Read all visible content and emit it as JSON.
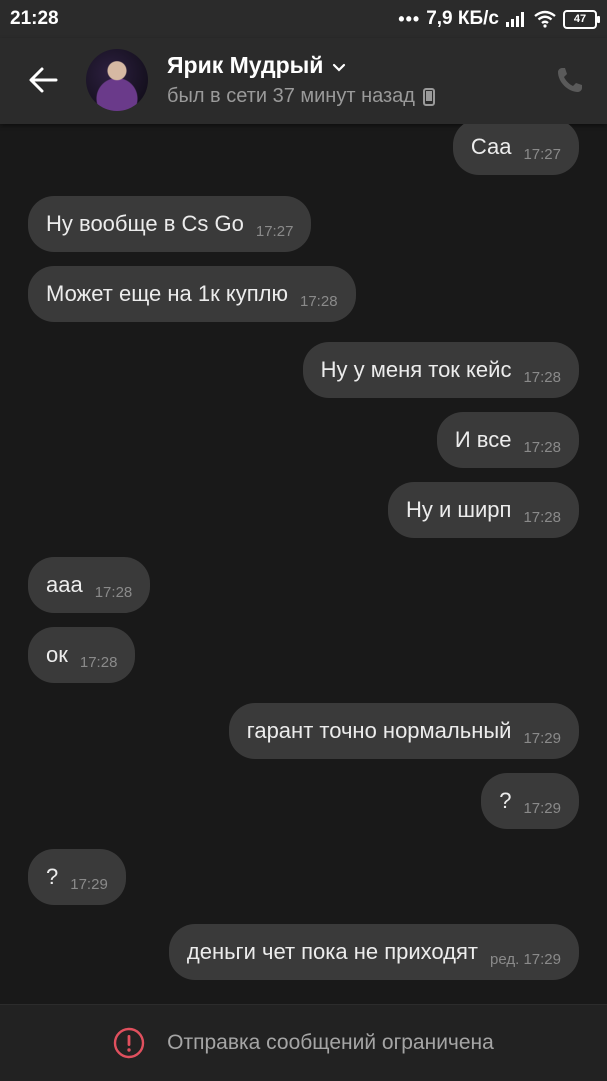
{
  "status_bar": {
    "time": "21:28",
    "dots": "•••",
    "speed": "7,9 КБ/с",
    "battery": "47"
  },
  "header": {
    "contact_name": "Ярик Мудрый",
    "last_seen": "был в сети 37 минут назад"
  },
  "messages": [
    {
      "dir": "out",
      "text": "Саа",
      "time": "17:27"
    },
    {
      "dir": "in",
      "text": "Ну вообще в Cs Go",
      "time": "17:27"
    },
    {
      "dir": "in",
      "text": "Может еще на 1к куплю",
      "time": "17:28"
    },
    {
      "dir": "out",
      "text": "Ну у меня ток кейс",
      "time": "17:28"
    },
    {
      "dir": "out",
      "text": "И все",
      "time": "17:28"
    },
    {
      "dir": "out",
      "text": "Ну и ширп",
      "time": "17:28"
    },
    {
      "dir": "in",
      "text": "ааа",
      "time": "17:28"
    },
    {
      "dir": "in",
      "text": "ок",
      "time": "17:28"
    },
    {
      "dir": "out",
      "text": "гарант точно нормальный",
      "time": "17:29"
    },
    {
      "dir": "out",
      "text": "?",
      "time": "17:29"
    },
    {
      "dir": "in",
      "text": "?",
      "time": "17:29"
    },
    {
      "dir": "out",
      "text": "деньги чет пока не приходят",
      "time": "ред. 17:29"
    }
  ],
  "footer": {
    "notice": "Отправка сообщений ограничена"
  },
  "colors": {
    "background": "#191919",
    "bar": "#2b2b2b",
    "bubble": "#3a3a3a",
    "warning": "#e0505e"
  }
}
